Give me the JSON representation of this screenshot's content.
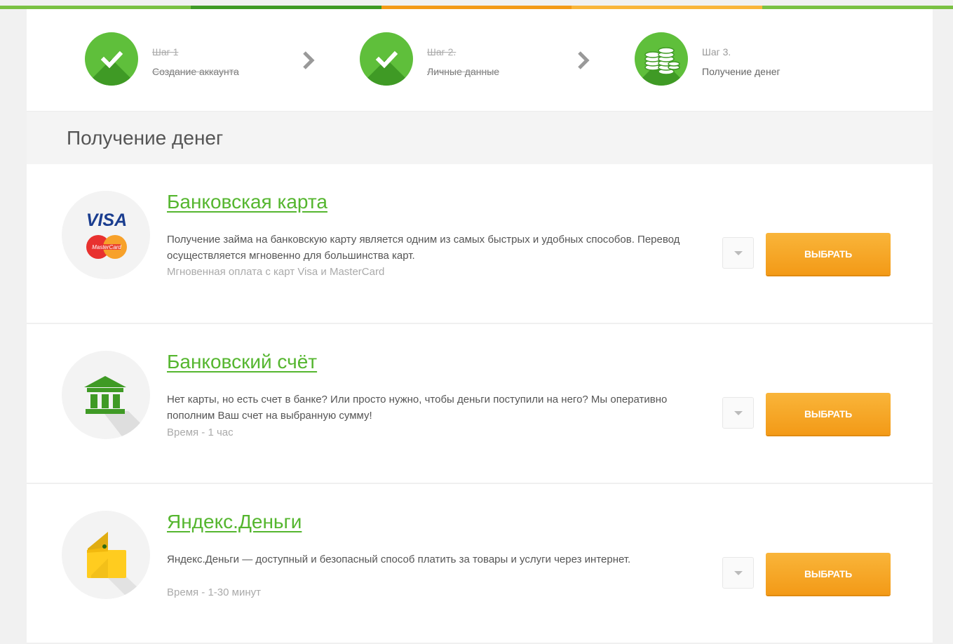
{
  "colors": {
    "accent_green": "#55b62f",
    "button_orange": "#f5a623",
    "progress_bar": [
      "#7ac143",
      "#3f9a25",
      "#f39a17",
      "#f9b53a",
      "#7ac143"
    ]
  },
  "steps": [
    {
      "label": "Шаг 1",
      "title": "Создание аккаунта",
      "status": "done",
      "icon": "check-icon"
    },
    {
      "label": "Шаг 2.",
      "title": "Личные данные",
      "status": "done",
      "icon": "check-icon"
    },
    {
      "label": "Шаг 3.",
      "title": "Получение денег",
      "status": "current",
      "icon": "coins-icon"
    }
  ],
  "section": {
    "title": "Получение денег"
  },
  "options": [
    {
      "title": "Банковская карта",
      "description": "Получение займа на банковскую карту является одним из самых быстрых и удобных способов. Перевод осуществляется мгновенно для большинства карт.",
      "note": "Мгновенная оплата с карт Visa и MasterCard",
      "button": "ВЫБРАТЬ",
      "icon": "visa-mastercard-icon",
      "icon_text": {
        "visa": "VISA",
        "mastercard": "MasterCard"
      }
    },
    {
      "title": "Банковский счёт",
      "description": "Нет карты, но есть счет в банке? Или просто нужно, чтобы деньги поступили на него? Мы оперативно пополним Ваш счет на выбранную сумму!",
      "note": "Время - 1 час",
      "button": "ВЫБРАТЬ",
      "icon": "bank-icon"
    },
    {
      "title": "Яндекс.Деньги",
      "description": "Яндекс.Деньги — доступный и безопасный способ платить за товары и услуги через интернет.",
      "note": "Время - 1-30 минут",
      "button": "ВЫБРАТЬ",
      "icon": "wallet-icon"
    }
  ]
}
